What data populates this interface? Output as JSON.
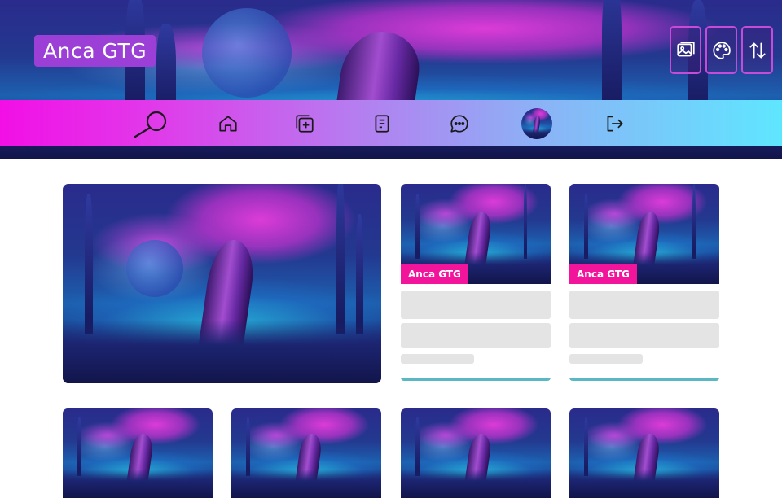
{
  "site": {
    "title": "Anca GTG"
  },
  "header_tools": [
    {
      "name": "wallpaper-button",
      "icon": "image-icon"
    },
    {
      "name": "theme-button",
      "icon": "palette-icon"
    },
    {
      "name": "sort-button",
      "icon": "swap-vertical-icon"
    }
  ],
  "nav": {
    "items": [
      {
        "name": "nav-search",
        "icon": "search-icon"
      },
      {
        "name": "nav-home",
        "icon": "home-icon"
      },
      {
        "name": "nav-new-post",
        "icon": "add-square-icon"
      },
      {
        "name": "nav-pages",
        "icon": "document-icon"
      },
      {
        "name": "nav-messages",
        "icon": "chat-bubble-icon"
      },
      {
        "name": "nav-profile",
        "icon": "avatar"
      },
      {
        "name": "nav-logout",
        "icon": "logout-icon"
      }
    ]
  },
  "posts": [
    {
      "author": "Anca GTG"
    },
    {
      "author": "Anca GTG"
    }
  ],
  "colors": {
    "accent": "#9b3fd6",
    "badge": "#f2149a",
    "nav_start": "#f20fe6",
    "nav_end": "#5fe6ff",
    "underline": "#5ab8c4"
  }
}
